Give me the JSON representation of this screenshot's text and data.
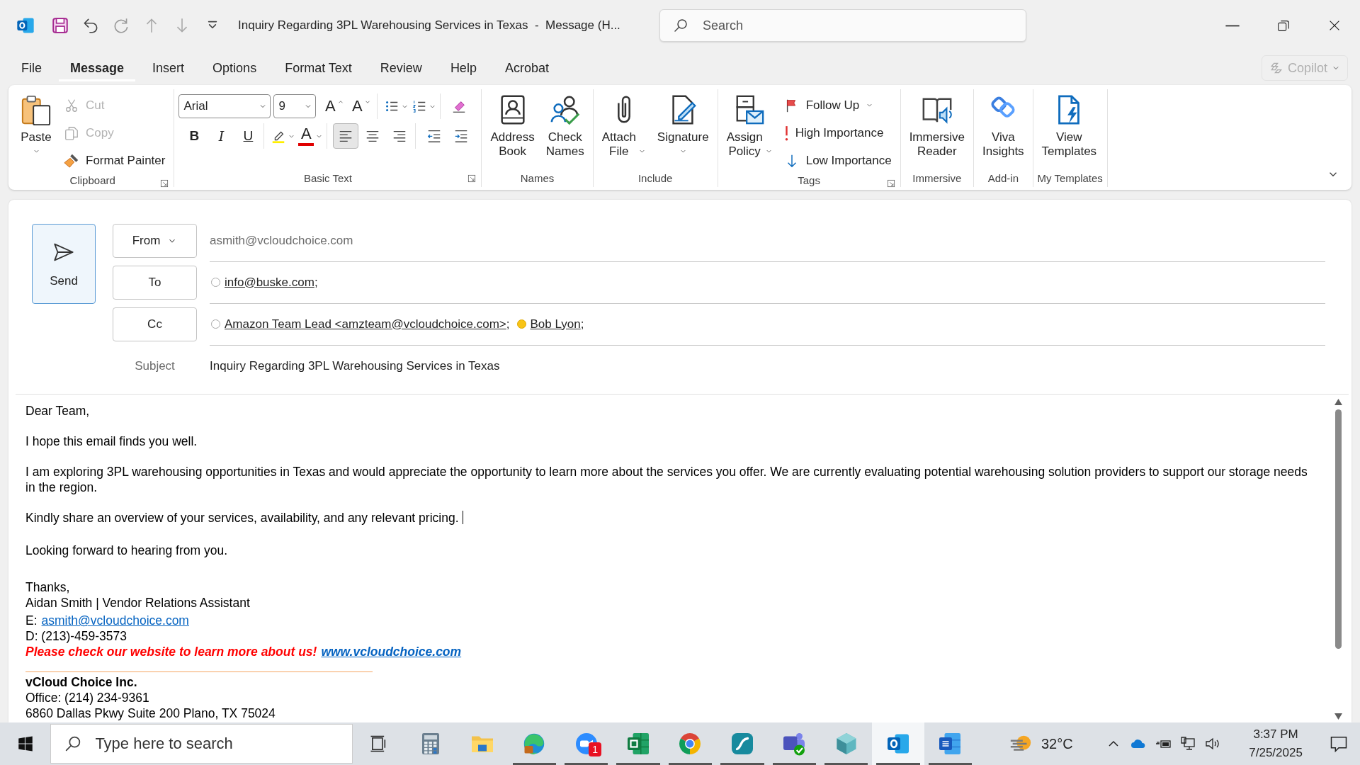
{
  "title_bar": {
    "title": "Inquiry Regarding 3PL Warehousing Services in Texas  -  Message (H...",
    "search": {
      "placeholder": "Search"
    }
  },
  "menu_tabs": [
    {
      "label": "File",
      "selected": false
    },
    {
      "label": "Message",
      "selected": true
    },
    {
      "label": "Insert",
      "selected": false
    },
    {
      "label": "Options",
      "selected": false
    },
    {
      "label": "Format Text",
      "selected": false
    },
    {
      "label": "Review",
      "selected": false
    },
    {
      "label": "Help",
      "selected": false
    },
    {
      "label": "Acrobat",
      "selected": false
    }
  ],
  "copilot": {
    "label": "Copilot",
    "disabled": true
  },
  "ribbon": {
    "groups": [
      {
        "kind": "standard",
        "label": "Clipboard",
        "launcher": true,
        "items": [
          {
            "kind": "large",
            "label": "Paste",
            "dropdown": true
          },
          {
            "kind": "small",
            "label": "Cut",
            "disabled": true
          },
          {
            "kind": "small",
            "label": "Copy",
            "disabled": true
          },
          {
            "kind": "small",
            "label": "Format Painter",
            "disabled": false
          }
        ]
      },
      {
        "kind": "basic_text",
        "label": "Basic Text",
        "launcher": true,
        "font": {
          "value": "Arial"
        },
        "size": {
          "value": "9"
        },
        "rows": [
          {
            "clusters": [
              {
                "items": [
                  {
                    "kind": "grow",
                    "label": "A"
                  },
                  {
                    "kind": "shrink",
                    "label": "A"
                  }
                ]
              },
              {
                "items": [
                  {
                    "kind": "icon",
                    "dropdown": true
                  },
                  {
                    "kind": "icon",
                    "dropdown": true
                  }
                ]
              },
              {
                "items": [
                  {
                    "kind": "icon"
                  }
                ]
              }
            ]
          },
          {
            "clusters": [
              {
                "items": [
                  {
                    "kind": "bold",
                    "label": "B"
                  },
                  {
                    "kind": "italic",
                    "label": "I"
                  },
                  {
                    "kind": "underline",
                    "label": "U"
                  }
                ]
              },
              {
                "items": [
                  {
                    "kind": "icon",
                    "dropdown": true
                  },
                  {
                    "kind": "color_letter",
                    "label": "A",
                    "dropdown": true
                  }
                ]
              },
              {
                "items": [
                  {
                    "kind": "icon",
                    "selected": true
                  },
                  {
                    "kind": "icon",
                    "selected": false
                  },
                  {
                    "kind": "icon",
                    "selected": false
                  }
                ]
              },
              {
                "items": [
                  {
                    "kind": "icon"
                  },
                  {
                    "kind": "icon"
                  }
                ]
              }
            ]
          }
        ]
      },
      {
        "kind": "standard",
        "label": "Names",
        "items": [
          {
            "kind": "large",
            "label": "Address Book"
          },
          {
            "kind": "large",
            "label": "Check Names"
          }
        ]
      },
      {
        "kind": "standard",
        "label": "Include",
        "items": [
          {
            "kind": "large",
            "label": "Attach File",
            "dropdown": true
          },
          {
            "kind": "large",
            "label": "Signature",
            "dropdown": true
          }
        ]
      },
      {
        "kind": "standard",
        "label": "Tags",
        "launcher": true,
        "items": [
          {
            "kind": "large",
            "label": "Assign Policy",
            "dropdown": true
          },
          {
            "kind": "small",
            "label": "Follow Up",
            "dropdown": true
          },
          {
            "kind": "small",
            "label": "High Importance"
          },
          {
            "kind": "small",
            "label": "Low Importance"
          }
        ]
      },
      {
        "kind": "standard",
        "label": "Immersive",
        "items": [
          {
            "kind": "large",
            "label": "Immersive Reader"
          }
        ]
      },
      {
        "kind": "standard",
        "label": "Add-in",
        "items": [
          {
            "kind": "large",
            "label": "Viva Insights"
          }
        ]
      },
      {
        "kind": "standard",
        "label": "My Templates",
        "items": [
          {
            "kind": "large",
            "label": "View Templates"
          }
        ]
      }
    ]
  },
  "compose": {
    "send": {
      "label": "Send"
    },
    "fields": [
      {
        "kind": "from",
        "label": "From",
        "value": "asmith@vcloudchoice.com"
      },
      {
        "kind": "recipients",
        "label": "To",
        "recipients": [
          {
            "name": "info@buske.com",
            "separator": ";",
            "kind": "unknown"
          }
        ]
      },
      {
        "kind": "recipients",
        "label": "Cc",
        "recipients": [
          {
            "name": "Amazon Team Lead <amzteam@vcloudchoice.com>",
            "separator": ";",
            "kind": "unknown"
          },
          {
            "name": "Bob Lyon",
            "separator": ";",
            "kind": "away"
          }
        ]
      },
      {
        "kind": "subject",
        "label": "Subject",
        "value": "Inquiry Regarding 3PL Warehousing Services in Texas"
      }
    ]
  },
  "body": {
    "paragraphs": [
      {
        "text": "Dear Team,",
        "cursor": false
      },
      {
        "text": "I hope this email finds you well.",
        "cursor": false
      },
      {
        "text": "I am exploring 3PL warehousing opportunities in Texas and would appreciate the opportunity to learn more about the services you offer. We are currently evaluating potential warehousing solution providers to support our storage needs in the region.",
        "cursor": false
      },
      {
        "text": "Kindly share an overview of your services, availability, and any relevant pricing. ",
        "cursor": true
      },
      {
        "text": "Looking forward to hearing from you.",
        "cursor": false
      }
    ],
    "signature": {
      "closing": "Thanks,",
      "name_line": "Aidan Smith | Vendor Relations Assistant",
      "email": {
        "label": "E:",
        "link": "asmith@vcloudchoice.com"
      },
      "direct": "D: (213)-459-3573",
      "promo": {
        "text": "Please check our website to learn more about us!",
        "link": "www.vcloudchoice.com"
      },
      "company": "vCloud Choice Inc.",
      "office": "Office: (214) 234-9361",
      "address": "6860 Dallas Pkwy Suite 200 Plano, TX 75024"
    }
  },
  "taskbar": {
    "search": {
      "placeholder": "Type here to search"
    },
    "apps": [
      {
        "selected": false,
        "running": false
      },
      {
        "selected": false,
        "running": false
      },
      {
        "selected": false,
        "running": true
      },
      {
        "selected": false,
        "running": true,
        "badge": "1"
      },
      {
        "selected": false,
        "running": true
      },
      {
        "selected": false,
        "running": true
      },
      {
        "selected": false,
        "running": true
      },
      {
        "selected": false,
        "running": true
      },
      {
        "selected": false,
        "running": true
      },
      {
        "selected": true,
        "running": true
      },
      {
        "selected": false,
        "running": true
      }
    ],
    "weather": {
      "temperature": "32°C"
    },
    "clock": {
      "time": "3:37 PM",
      "date": "7/25/2025"
    }
  }
}
